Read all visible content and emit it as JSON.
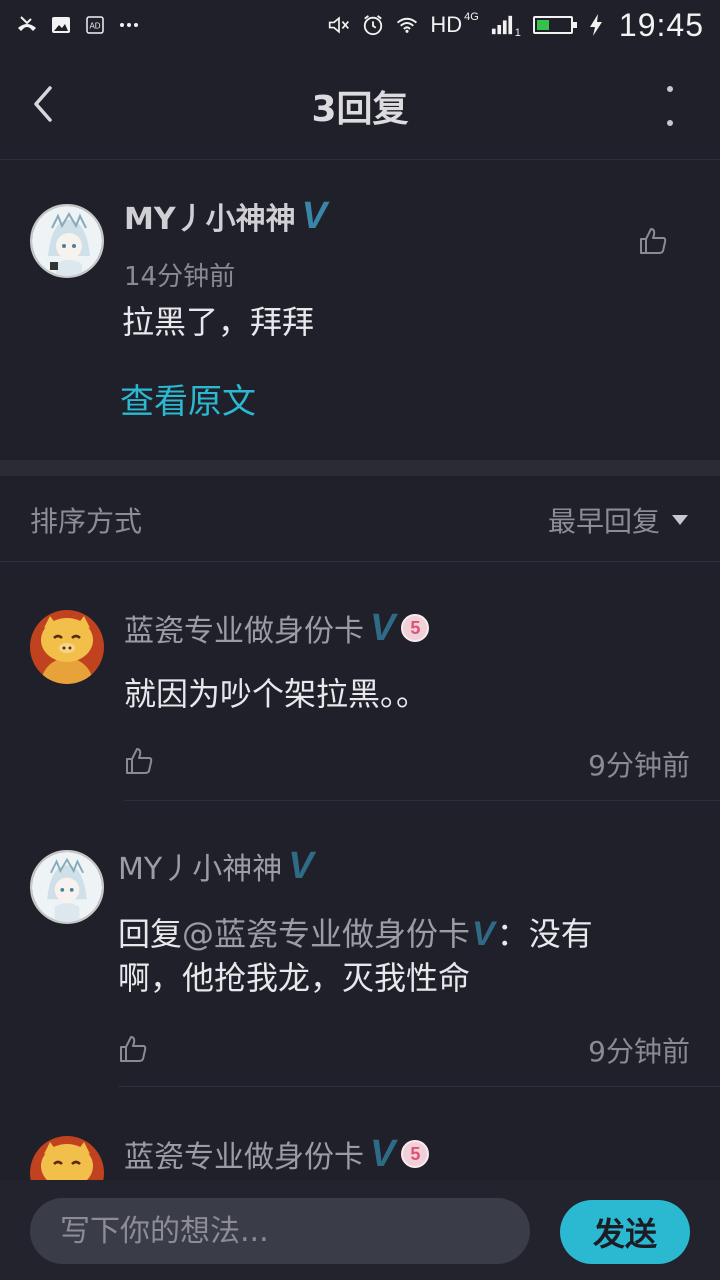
{
  "status": {
    "network": "HD",
    "network_type": "4G",
    "signal_sub": "1",
    "time": "19:45",
    "battery_level": 0.45,
    "colors": {
      "battery": "#35c24a"
    }
  },
  "header": {
    "title": "3回复"
  },
  "main_post": {
    "username": "MY丿小神神",
    "time": "14分钟前",
    "content": "拉黑了，拜拜",
    "view_original": "查看原文"
  },
  "sort": {
    "label": "排序方式",
    "selected": "最早回复"
  },
  "replies": [
    {
      "username": "蓝瓷专业做身份卡",
      "level": "5",
      "content": "就因为吵个架拉黑。。",
      "time": "9分钟前"
    },
    {
      "username": "MY丿小神神",
      "reply_prefix": "回复",
      "mention": "@蓝瓷专业做身份卡",
      "content_line1": "：没有",
      "content_line2": "啊，他抢我龙，灭我性命",
      "time": "9分钟前"
    },
    {
      "username": "蓝瓷专业做身份卡",
      "level": "5"
    }
  ],
  "composer": {
    "placeholder": "写下你的想法...",
    "send_label": "发送"
  },
  "colors": {
    "background": "#1f2029",
    "accent": "#2bb8d1",
    "verified": "#3a86a8"
  }
}
